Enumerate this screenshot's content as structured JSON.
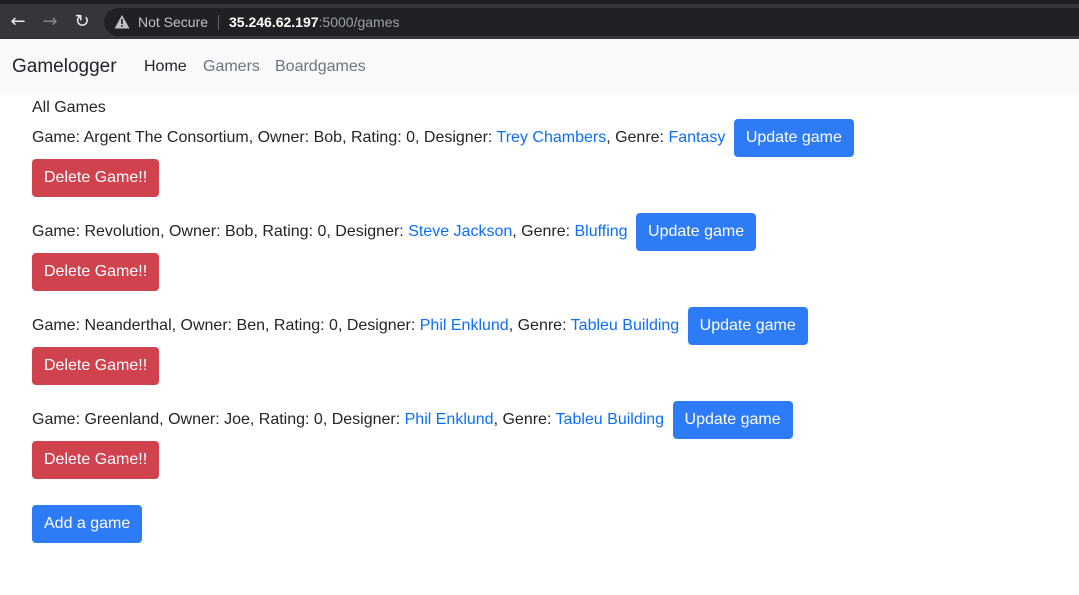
{
  "browser": {
    "security_label": "Not Secure",
    "url_host": "35.246.62.197",
    "url_path": ":5000/games"
  },
  "navbar": {
    "brand": "Gamelogger",
    "links": [
      {
        "label": "Home",
        "active": true
      },
      {
        "label": "Gamers",
        "active": false
      },
      {
        "label": "Boardgames",
        "active": false
      }
    ]
  },
  "page": {
    "heading": "All Games",
    "update_label": "Update game",
    "delete_label": "Delete Game!!",
    "add_label": "Add a game",
    "games": [
      {
        "prefix": "Game: Argent The Consortium, Owner: Bob, Rating: 0, Designer: ",
        "designer": "Trey Chambers",
        "genre_prefix": ", Genre: ",
        "genre": "Fantasy"
      },
      {
        "prefix": "Game: Revolution, Owner: Bob, Rating: 0, Designer: ",
        "designer": "Steve Jackson",
        "genre_prefix": ", Genre: ",
        "genre": "Bluffing"
      },
      {
        "prefix": "Game: Neanderthal, Owner: Ben, Rating: 0, Designer: ",
        "designer": "Phil Enklund",
        "genre_prefix": ", Genre: ",
        "genre": "Tableu Building"
      },
      {
        "prefix": "Game: Greenland, Owner: Joe, Rating: 0, Designer: ",
        "designer": "Phil Enklund",
        "genre_prefix": ", Genre: ",
        "genre": "Tableu Building"
      }
    ]
  },
  "colors": {
    "primary": "#2d7bf6",
    "danger": "#d0424e",
    "link": "#0d6efd",
    "navbar_bg": "#f8f9fa"
  }
}
